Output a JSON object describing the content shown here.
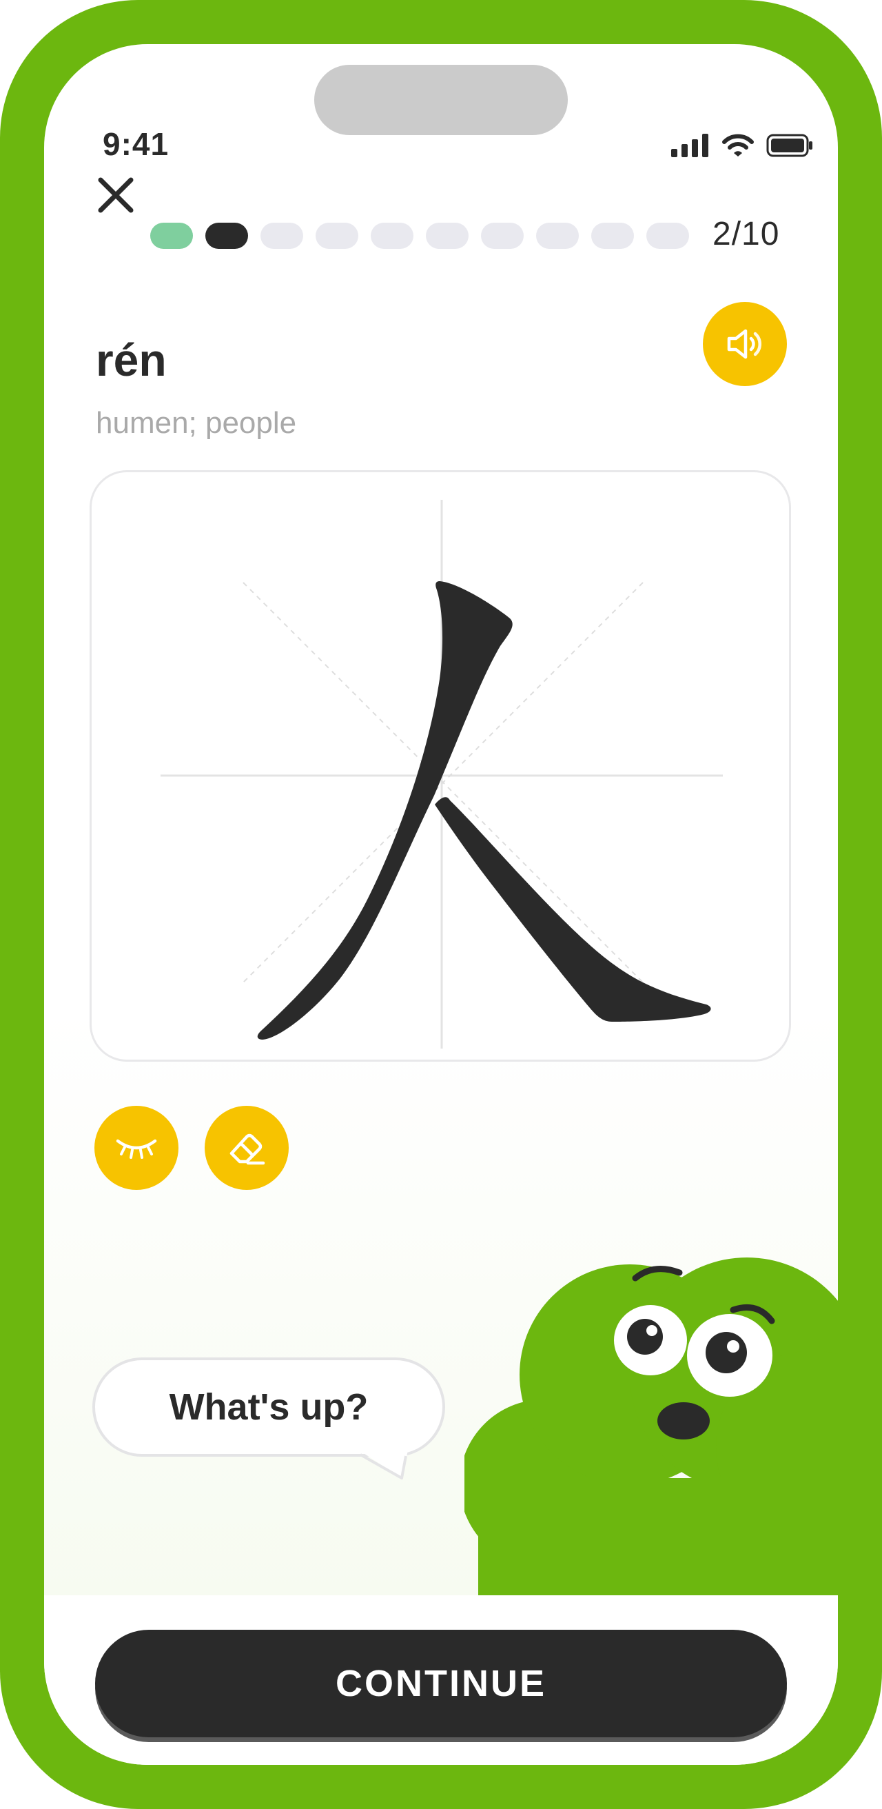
{
  "status_bar": {
    "time": "9:41"
  },
  "header": {
    "progress_text": "2/10",
    "progress_current": 2,
    "progress_total": 10
  },
  "word": {
    "pinyin": "rén",
    "meaning": "humen; people",
    "character": "人"
  },
  "tools": {
    "hint_icon": "eye-closed-icon",
    "eraser_icon": "eraser-icon"
  },
  "speech_bubble": {
    "text": "What's up?"
  },
  "footer": {
    "continue_label": "CONTINUE"
  },
  "colors": {
    "frame_green": "#6cb70f",
    "accent_yellow": "#f7c300",
    "done_segment": "#7fcf9e",
    "current_segment": "#2a2a2a",
    "pending_segment": "#e9e9ef",
    "dark": "#2a2a2a"
  }
}
